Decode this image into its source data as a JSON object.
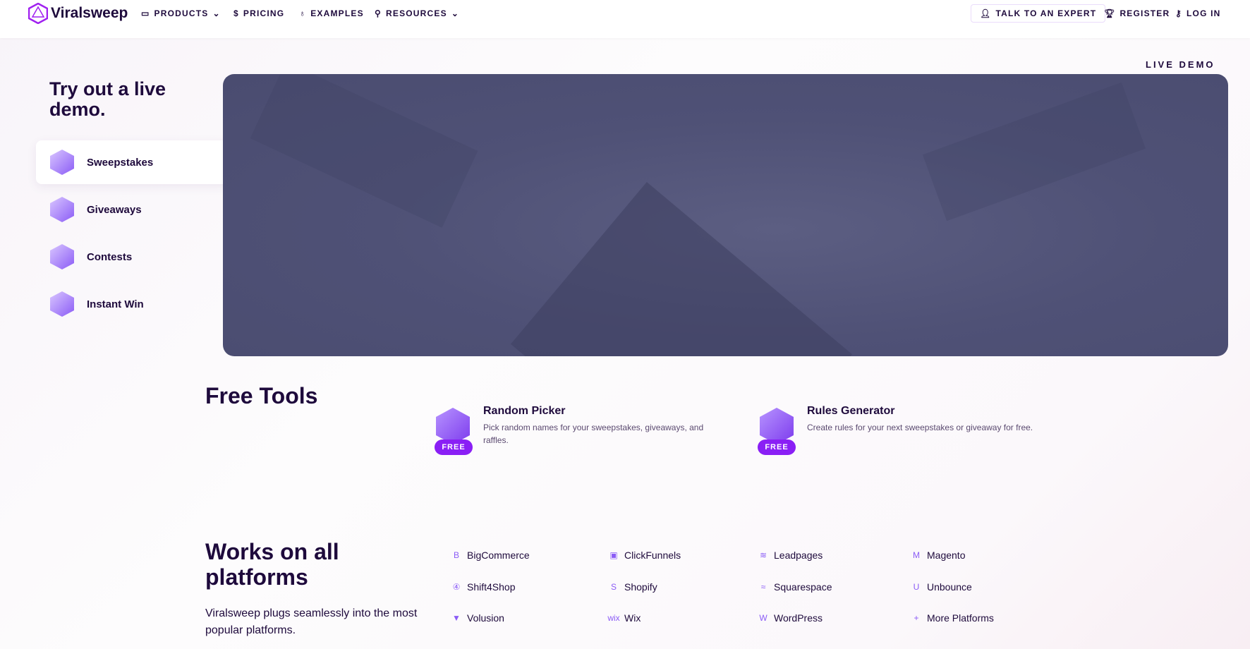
{
  "nav": {
    "logo": "Viralsweep",
    "products": "PRODUCTS",
    "pricing": "PRICING",
    "examples": "EXAMPLES",
    "resources": "RESOURCES",
    "expert": "TALK TO AN EXPERT",
    "register": "REGISTER",
    "login": "LOG IN"
  },
  "hero": {
    "title": "Try out a live demo.",
    "live_demo": "LIVE DEMO",
    "items": [
      {
        "label": "Sweepstakes"
      },
      {
        "label": "Giveaways"
      },
      {
        "label": "Contests"
      },
      {
        "label": "Instant Win"
      }
    ]
  },
  "tools": {
    "heading": "Free Tools",
    "items": [
      {
        "title": "Random Picker",
        "desc": "Pick random names for your sweepstakes, giveaways, and raffles.",
        "badge": "FREE"
      },
      {
        "title": "Rules Generator",
        "desc": "Create rules for your next sweepstakes or giveaway for free.",
        "badge": "FREE"
      }
    ]
  },
  "platforms": {
    "heading": "Works on all platforms",
    "desc": "Viralsweep plugs seamlessly into the most popular platforms.",
    "items": [
      {
        "label": "BigCommerce",
        "icon": "B"
      },
      {
        "label": "ClickFunnels",
        "icon": "▣"
      },
      {
        "label": "Leadpages",
        "icon": "≋"
      },
      {
        "label": "Magento",
        "icon": "M"
      },
      {
        "label": "Shift4Shop",
        "icon": "④"
      },
      {
        "label": "Shopify",
        "icon": "S"
      },
      {
        "label": "Squarespace",
        "icon": "≈"
      },
      {
        "label": "Unbounce",
        "icon": "U"
      },
      {
        "label": "Volusion",
        "icon": "▼"
      },
      {
        "label": "Wix",
        "icon": "wix"
      },
      {
        "label": "WordPress",
        "icon": "W"
      },
      {
        "label": "More Platforms",
        "icon": "+"
      }
    ]
  },
  "colors": {
    "accent": "#8a1ff5",
    "text": "#1e0a3c",
    "demo_bg": "#4f5176"
  }
}
